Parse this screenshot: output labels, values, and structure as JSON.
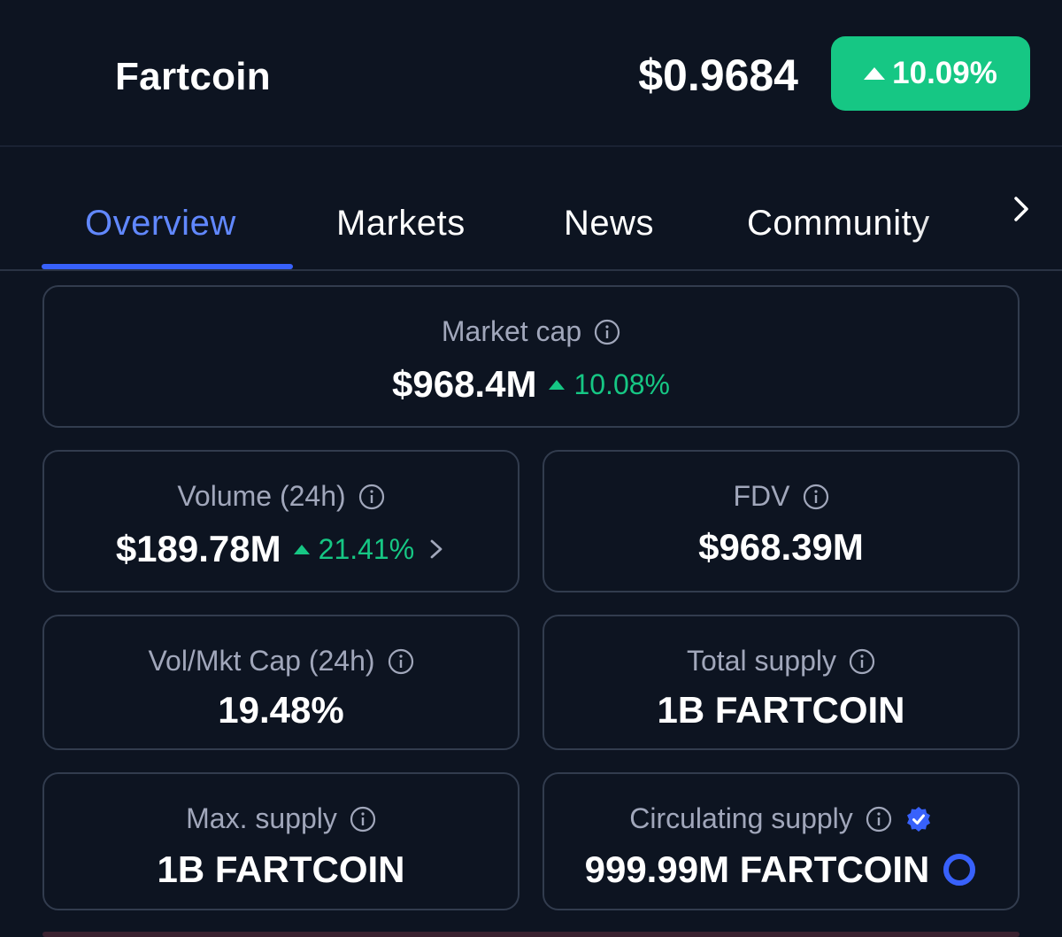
{
  "header": {
    "coin_name": "Fartcoin",
    "price": "$0.9684",
    "change": "10.09%",
    "change_color": "#16c784"
  },
  "tabs": [
    {
      "label": "Overview",
      "active": true
    },
    {
      "label": "Markets",
      "active": false
    },
    {
      "label": "News",
      "active": false
    },
    {
      "label": "Community",
      "active": false
    }
  ],
  "stats": {
    "market_cap": {
      "label": "Market cap",
      "value": "$968.4M",
      "change": "10.08%"
    },
    "volume": {
      "label": "Volume (24h)",
      "value": "$189.78M",
      "change": "21.41%"
    },
    "fdv": {
      "label": "FDV",
      "value": "$968.39M"
    },
    "vol_mkt_cap": {
      "label": "Vol/Mkt Cap (24h)",
      "value": "19.48%"
    },
    "total_supply": {
      "label": "Total supply",
      "value": "1B FARTCOIN"
    },
    "max_supply": {
      "label": "Max. supply",
      "value": "1B FARTCOIN"
    },
    "circulating_supply": {
      "label": "Circulating supply",
      "value": "999.99M FARTCOIN",
      "fraction": 0.99999
    }
  },
  "colors": {
    "background": "#0d1421",
    "accent": "#3861fb",
    "positive": "#16c784",
    "label": "#a1a7bb"
  },
  "icons": [
    "info-icon",
    "chevron-right-icon",
    "verified-badge-icon",
    "progress-ring-icon",
    "triangle-up-icon"
  ]
}
